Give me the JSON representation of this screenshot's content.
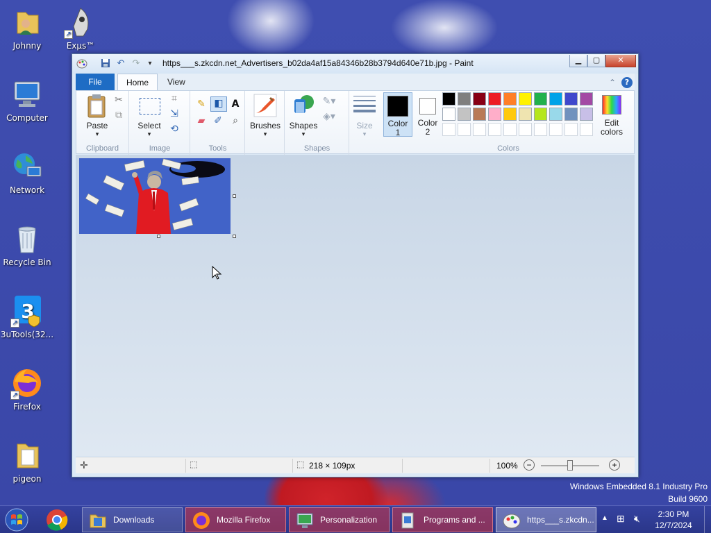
{
  "desktop": {
    "icons": [
      {
        "label": "Johnny",
        "icon": "user-folder-icon"
      },
      {
        "label": "Exµs™",
        "icon": "exus-app-icon"
      },
      {
        "label": "Computer",
        "icon": "computer-icon"
      },
      {
        "label": "Network",
        "icon": "network-icon"
      },
      {
        "label": "Recycle Bin",
        "icon": "recycle-bin-icon"
      },
      {
        "label": "3uTools(32...",
        "icon": "3utools-icon"
      },
      {
        "label": "Firefox",
        "icon": "firefox-icon"
      },
      {
        "label": "pigeon",
        "icon": "folder-icon"
      }
    ],
    "os_watermark": {
      "line1": "Windows Embedded 8.1 Industry Pro",
      "line2": "Build 9600"
    }
  },
  "paint": {
    "title": "https___s.zkcdn.net_Advertisers_b02da4af15a84346b28b3794d640e71b.jpg - Paint",
    "tabs": {
      "file": "File",
      "home": "Home",
      "view": "View"
    },
    "groups": {
      "clipboard": {
        "label": "Clipboard",
        "paste": "Paste"
      },
      "image": {
        "label": "Image",
        "select": "Select"
      },
      "tools": {
        "label": "Tools"
      },
      "brushes": {
        "label": "Brushes"
      },
      "shapes": {
        "label": "Shapes",
        "button": "Shapes"
      },
      "size": {
        "label": "Size"
      },
      "colors": {
        "label": "Colors",
        "color1": "Color 1",
        "color1_line1": "Color",
        "color1_line2": "1",
        "color2_line1": "Color",
        "color2_line2": "2",
        "edit_line1": "Edit",
        "edit_line2": "colors",
        "color1_value": "#000000",
        "color2_value": "#ffffff",
        "palette_row1": [
          "#000000",
          "#7f7f7f",
          "#880015",
          "#ed1c24",
          "#ff7f27",
          "#fff200",
          "#22b14c",
          "#00a2e8",
          "#3f48cc",
          "#a349a4"
        ],
        "palette_row2": [
          "#ffffff",
          "#c3c3c3",
          "#b97a57",
          "#ffaec9",
          "#ffc90e",
          "#efe4b0",
          "#b5e61d",
          "#99d9ea",
          "#7092be",
          "#c8bfe7"
        ]
      }
    },
    "status": {
      "dimensions": "218 × 109px",
      "zoom": "100%"
    }
  },
  "taskbar": {
    "items": [
      {
        "label": "Downloads",
        "icon": "folder-icon"
      },
      {
        "label": "Mozilla Firefox",
        "icon": "firefox-icon"
      },
      {
        "label": "Personalization",
        "icon": "personalization-icon"
      },
      {
        "label": "Programs and ...",
        "icon": "programs-icon"
      },
      {
        "label": "https___s.zkcdn...",
        "icon": "paint-icon"
      }
    ],
    "clock": {
      "time": "2:30 PM",
      "date": "12/7/2024"
    }
  }
}
